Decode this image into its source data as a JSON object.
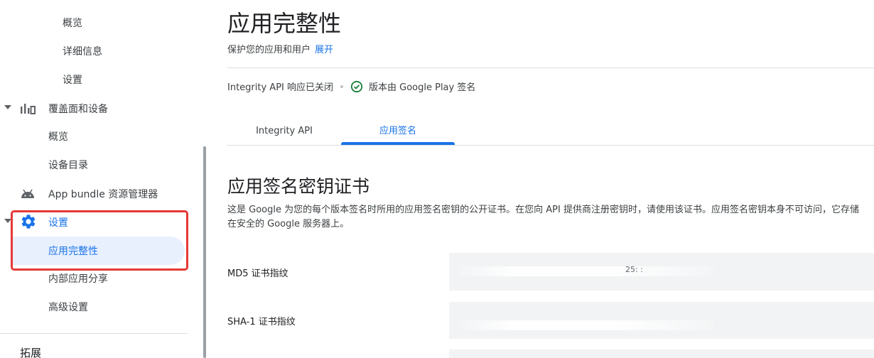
{
  "sidebar": {
    "items": [
      {
        "label": "概览"
      },
      {
        "label": "详细信息"
      },
      {
        "label": "设置"
      },
      {
        "label": "覆盖面和设备"
      },
      {
        "label": "概览"
      },
      {
        "label": "设备目录"
      },
      {
        "label": "App bundle 资源管理器"
      },
      {
        "label": "设置"
      },
      {
        "label": "应用完整性"
      },
      {
        "label": "内部应用分享"
      },
      {
        "label": "高级设置"
      }
    ],
    "section_heading": "拓展"
  },
  "header": {
    "title": "应用完整性",
    "subtitle": "保护您的应用和用户",
    "expand_link": "展开"
  },
  "status": {
    "integrity_api": "Integrity API 响应已关闭",
    "signing": "版本由 Google Play 签名"
  },
  "tabs": [
    {
      "label": "Integrity API"
    },
    {
      "label": "应用签名"
    }
  ],
  "section": {
    "title": "应用签名密钥证书",
    "description": "这是 Google 为您的每个版本签名时所用的应用签名密钥的公开证书。在您向 API 提供商注册密钥时，请使用该证书。应用签名密钥本身不可访问，它存储在安全的 Google 服务器上。",
    "fields": [
      {
        "label": "MD5 证书指纹",
        "value_fragment": "25: :"
      },
      {
        "label": "SHA-1 证书指纹",
        "value_fragment": ""
      }
    ]
  },
  "colors": {
    "accent": "#1a73e8",
    "selected_bg": "#e8f0fe",
    "highlight": "#e53935",
    "success": "#188038"
  }
}
